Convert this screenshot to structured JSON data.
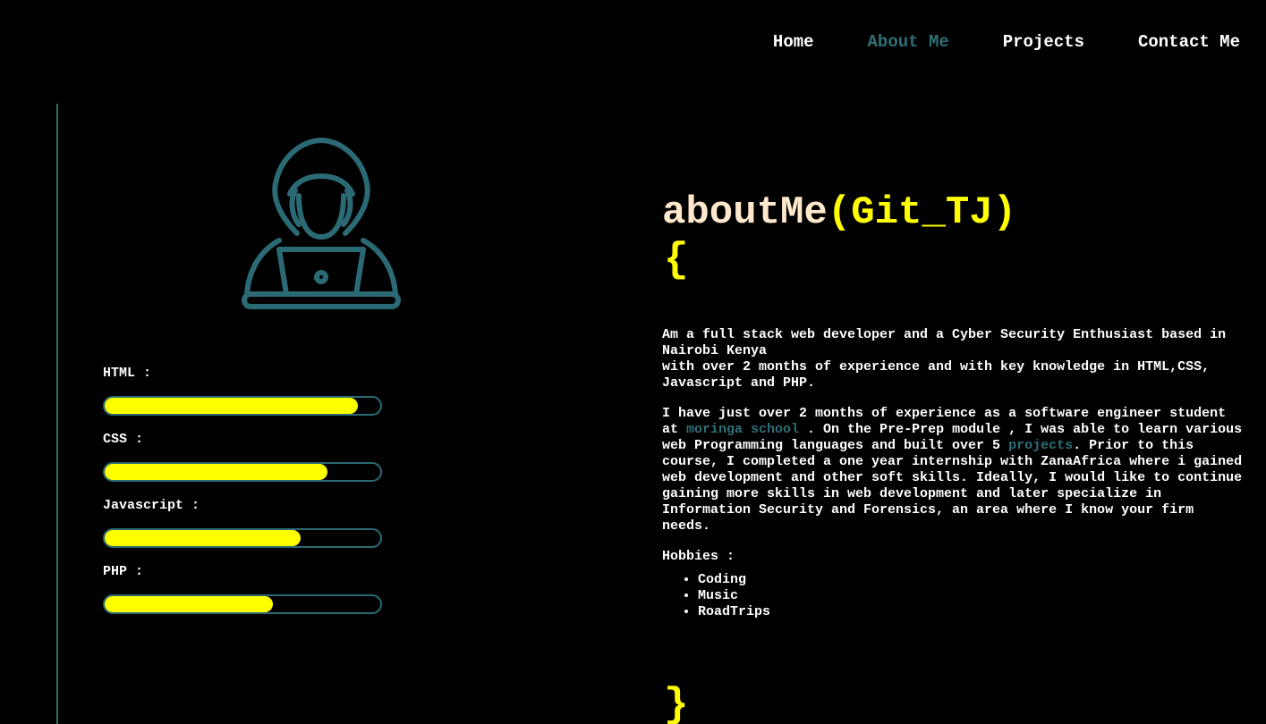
{
  "nav": {
    "items": [
      {
        "label": "Home",
        "active": false
      },
      {
        "label": "About Me",
        "active": true
      },
      {
        "label": "Projects",
        "active": false
      },
      {
        "label": "Contact Me",
        "active": false
      }
    ]
  },
  "colors": {
    "background": "#000000",
    "accent": "#2f6f78",
    "highlight": "#ffff00",
    "heading": "#ffe8cc"
  },
  "avatar": {
    "icon": "hacker-laptop-icon"
  },
  "skills": [
    {
      "label": "HTML :",
      "level": 0.92
    },
    {
      "label": "CSS :",
      "level": 0.81
    },
    {
      "label": "Javascript :",
      "level": 0.71
    },
    {
      "label": "PHP :",
      "level": 0.61
    }
  ],
  "about": {
    "heading_fn": "aboutMe",
    "heading_open_paren": "(",
    "heading_arg": "Git_TJ",
    "heading_close_paren": ")",
    "open_brace": "{",
    "close_brace": "}",
    "intro_line1": "Am a full stack web developer and a Cyber Security Enthusiast based in Nairobi Kenya",
    "intro_line2": "with over 2 months of experience and with key knowledge in HTML,CSS, Javascript and PHP.",
    "para2_part1": "I have just over 2 months of experience as a software engineer student at ",
    "para2_link1": "moringa school",
    "para2_part2": " . On the Pre-Prep module , I was able to learn various web Programming languages and built over 5 ",
    "para2_link2": "projects",
    "para2_part3": ". Prior to this course, I completed a one year internship with ZanaAfrica where i gained web development and other soft skills. Ideally, I would like to continue gaining more skills in web development and later specialize in Information Security and Forensics, an area where I know your firm needs.",
    "hobbies_label": "Hobbies :",
    "hobbies": [
      "Coding",
      "Music",
      "RoadTrips"
    ]
  }
}
